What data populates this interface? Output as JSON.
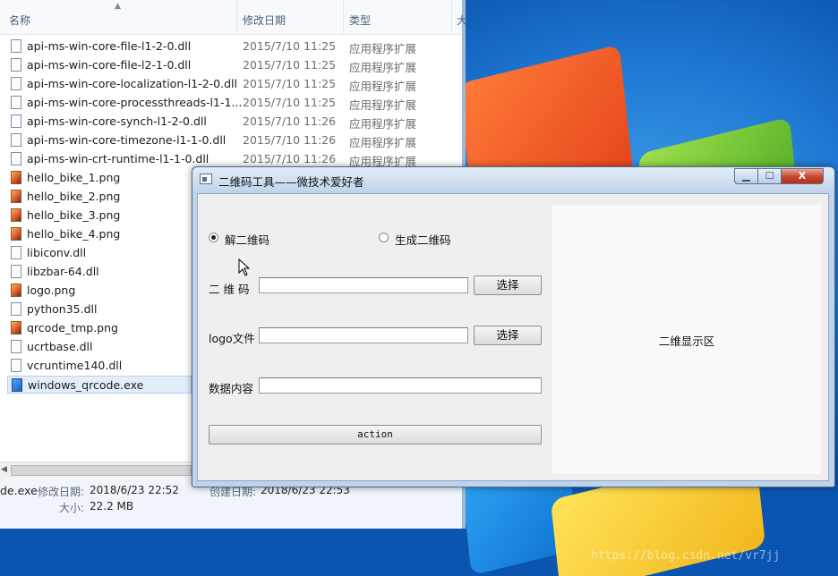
{
  "explorer": {
    "columns": {
      "name": "名称",
      "modified": "修改日期",
      "type": "类型",
      "extra": "大"
    },
    "files": [
      {
        "name": "api-ms-win-core-file-l1-2-0.dll",
        "date": "2015/7/10 11:25",
        "type": "应用程序扩展",
        "icon": "dll-file-icon"
      },
      {
        "name": "api-ms-win-core-file-l2-1-0.dll",
        "date": "2015/7/10 11:25",
        "type": "应用程序扩展",
        "icon": "dll-file-icon"
      },
      {
        "name": "api-ms-win-core-localization-l1-2-0.dll",
        "date": "2015/7/10 11:25",
        "type": "应用程序扩展",
        "icon": "dll-file-icon"
      },
      {
        "name": "api-ms-win-core-processthreads-l1-1...",
        "date": "2015/7/10 11:25",
        "type": "应用程序扩展",
        "icon": "dll-file-icon"
      },
      {
        "name": "api-ms-win-core-synch-l1-2-0.dll",
        "date": "2015/7/10 11:26",
        "type": "应用程序扩展",
        "icon": "dll-file-icon"
      },
      {
        "name": "api-ms-win-core-timezone-l1-1-0.dll",
        "date": "2015/7/10 11:26",
        "type": "应用程序扩展",
        "icon": "dll-file-icon"
      },
      {
        "name": "api-ms-win-crt-runtime-l1-1-0.dll",
        "date": "2015/7/10 11:26",
        "type": "应用程序扩展",
        "icon": "dll-file-icon"
      },
      {
        "name": "hello_bike_1.png",
        "date": "",
        "type": "",
        "icon": "png-file-icon"
      },
      {
        "name": "hello_bike_2.png",
        "date": "",
        "type": "",
        "icon": "png-file-icon"
      },
      {
        "name": "hello_bike_3.png",
        "date": "",
        "type": "",
        "icon": "png-file-icon"
      },
      {
        "name": "hello_bike_4.png",
        "date": "",
        "type": "",
        "icon": "png-file-icon"
      },
      {
        "name": "libiconv.dll",
        "date": "",
        "type": "",
        "icon": "dll-file-icon"
      },
      {
        "name": "libzbar-64.dll",
        "date": "",
        "type": "",
        "icon": "dll-file-icon"
      },
      {
        "name": "logo.png",
        "date": "",
        "type": "",
        "icon": "png-file-icon"
      },
      {
        "name": "python35.dll",
        "date": "",
        "type": "",
        "icon": "dll-file-icon"
      },
      {
        "name": "qrcode_tmp.png",
        "date": "",
        "type": "",
        "icon": "png-file-icon"
      },
      {
        "name": "ucrtbase.dll",
        "date": "",
        "type": "",
        "icon": "dll-file-icon"
      },
      {
        "name": "vcruntime140.dll",
        "date": "",
        "type": "",
        "icon": "dll-file-icon"
      },
      {
        "name": "windows_qrcode.exe",
        "date": "",
        "type": "",
        "icon": "exe-file-icon",
        "selected": true
      }
    ],
    "details": {
      "filename": "de.exe",
      "modified_label": "修改日期:",
      "modified_value": "2018/6/23 22:52",
      "created_label": "创建日期:",
      "created_value": "2018/6/23 22:53",
      "size_label": "大小:",
      "size_value": "22.2 MB"
    }
  },
  "dialog": {
    "title": "二维码工具——微技术爱好者",
    "caption_buttons": {
      "minimize": "▁",
      "maximize": "☐",
      "close": "X"
    },
    "radio_decode": "解二维码",
    "radio_generate": "生成二维码",
    "decode_selected": true,
    "qr_label": "二 维 码",
    "logo_label": "logo文件",
    "data_label": "数据内容",
    "qr_value": "",
    "logo_value": "",
    "data_value": "",
    "select_button": "选择",
    "select_button_2": "选择",
    "action_button": "action",
    "display_area_label": "二维显示区"
  },
  "desktop": {
    "watermark": "https://blog.csdn.net/vr7jj"
  }
}
